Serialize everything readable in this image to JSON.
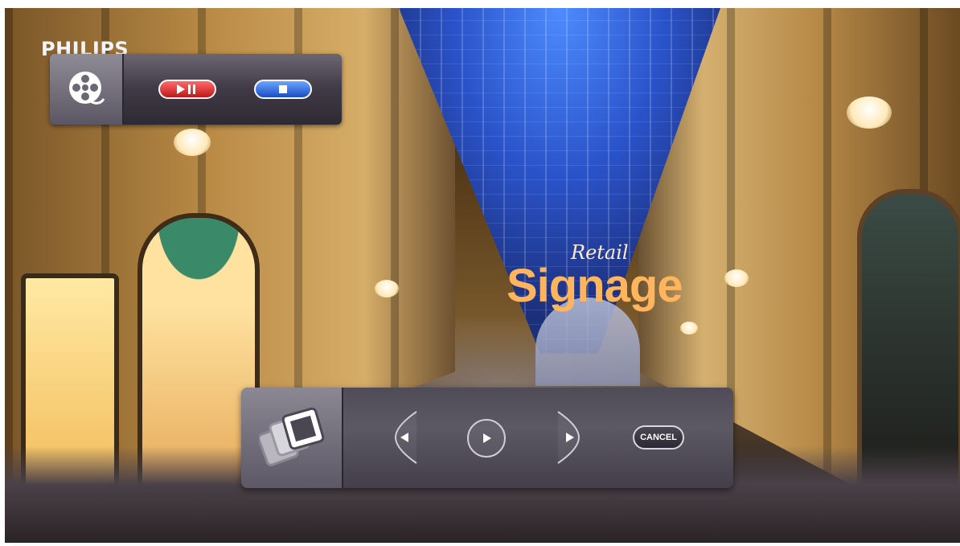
{
  "brand": "PHILIPS",
  "logo": {
    "retail": "Retail",
    "signage": "Signage"
  },
  "playback_panel": {
    "icon": "film-reel-icon",
    "play_pause_icon": "play-pause-icon",
    "stop_icon": "stop-icon",
    "colors": {
      "play_pause": "#d9262b",
      "stop": "#2a5fd8"
    }
  },
  "slideshow_panel": {
    "icon": "photo-slides-icon",
    "prev_icon": "chevron-left-icon",
    "play_icon": "play-icon",
    "next_icon": "chevron-right-icon",
    "cancel_label": "CANCEL"
  }
}
